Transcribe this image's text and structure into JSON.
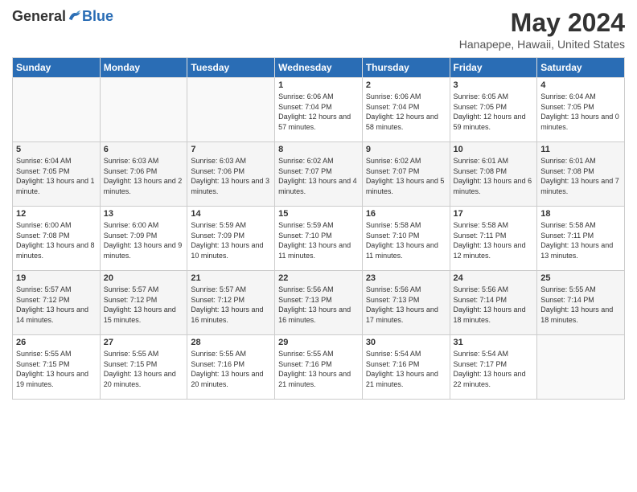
{
  "header": {
    "logo_general": "General",
    "logo_blue": "Blue",
    "title": "May 2024",
    "location": "Hanapepe, Hawaii, United States"
  },
  "days_of_week": [
    "Sunday",
    "Monday",
    "Tuesday",
    "Wednesday",
    "Thursday",
    "Friday",
    "Saturday"
  ],
  "weeks": [
    {
      "days": [
        {
          "number": "",
          "info": ""
        },
        {
          "number": "",
          "info": ""
        },
        {
          "number": "",
          "info": ""
        },
        {
          "number": "1",
          "info": "Sunrise: 6:06 AM\nSunset: 7:04 PM\nDaylight: 12 hours and 57 minutes."
        },
        {
          "number": "2",
          "info": "Sunrise: 6:06 AM\nSunset: 7:04 PM\nDaylight: 12 hours and 58 minutes."
        },
        {
          "number": "3",
          "info": "Sunrise: 6:05 AM\nSunset: 7:05 PM\nDaylight: 12 hours and 59 minutes."
        },
        {
          "number": "4",
          "info": "Sunrise: 6:04 AM\nSunset: 7:05 PM\nDaylight: 13 hours and 0 minutes."
        }
      ]
    },
    {
      "days": [
        {
          "number": "5",
          "info": "Sunrise: 6:04 AM\nSunset: 7:05 PM\nDaylight: 13 hours and 1 minute."
        },
        {
          "number": "6",
          "info": "Sunrise: 6:03 AM\nSunset: 7:06 PM\nDaylight: 13 hours and 2 minutes."
        },
        {
          "number": "7",
          "info": "Sunrise: 6:03 AM\nSunset: 7:06 PM\nDaylight: 13 hours and 3 minutes."
        },
        {
          "number": "8",
          "info": "Sunrise: 6:02 AM\nSunset: 7:07 PM\nDaylight: 13 hours and 4 minutes."
        },
        {
          "number": "9",
          "info": "Sunrise: 6:02 AM\nSunset: 7:07 PM\nDaylight: 13 hours and 5 minutes."
        },
        {
          "number": "10",
          "info": "Sunrise: 6:01 AM\nSunset: 7:08 PM\nDaylight: 13 hours and 6 minutes."
        },
        {
          "number": "11",
          "info": "Sunrise: 6:01 AM\nSunset: 7:08 PM\nDaylight: 13 hours and 7 minutes."
        }
      ]
    },
    {
      "days": [
        {
          "number": "12",
          "info": "Sunrise: 6:00 AM\nSunset: 7:08 PM\nDaylight: 13 hours and 8 minutes."
        },
        {
          "number": "13",
          "info": "Sunrise: 6:00 AM\nSunset: 7:09 PM\nDaylight: 13 hours and 9 minutes."
        },
        {
          "number": "14",
          "info": "Sunrise: 5:59 AM\nSunset: 7:09 PM\nDaylight: 13 hours and 10 minutes."
        },
        {
          "number": "15",
          "info": "Sunrise: 5:59 AM\nSunset: 7:10 PM\nDaylight: 13 hours and 11 minutes."
        },
        {
          "number": "16",
          "info": "Sunrise: 5:58 AM\nSunset: 7:10 PM\nDaylight: 13 hours and 11 minutes."
        },
        {
          "number": "17",
          "info": "Sunrise: 5:58 AM\nSunset: 7:11 PM\nDaylight: 13 hours and 12 minutes."
        },
        {
          "number": "18",
          "info": "Sunrise: 5:58 AM\nSunset: 7:11 PM\nDaylight: 13 hours and 13 minutes."
        }
      ]
    },
    {
      "days": [
        {
          "number": "19",
          "info": "Sunrise: 5:57 AM\nSunset: 7:12 PM\nDaylight: 13 hours and 14 minutes."
        },
        {
          "number": "20",
          "info": "Sunrise: 5:57 AM\nSunset: 7:12 PM\nDaylight: 13 hours and 15 minutes."
        },
        {
          "number": "21",
          "info": "Sunrise: 5:57 AM\nSunset: 7:12 PM\nDaylight: 13 hours and 16 minutes."
        },
        {
          "number": "22",
          "info": "Sunrise: 5:56 AM\nSunset: 7:13 PM\nDaylight: 13 hours and 16 minutes."
        },
        {
          "number": "23",
          "info": "Sunrise: 5:56 AM\nSunset: 7:13 PM\nDaylight: 13 hours and 17 minutes."
        },
        {
          "number": "24",
          "info": "Sunrise: 5:56 AM\nSunset: 7:14 PM\nDaylight: 13 hours and 18 minutes."
        },
        {
          "number": "25",
          "info": "Sunrise: 5:55 AM\nSunset: 7:14 PM\nDaylight: 13 hours and 18 minutes."
        }
      ]
    },
    {
      "days": [
        {
          "number": "26",
          "info": "Sunrise: 5:55 AM\nSunset: 7:15 PM\nDaylight: 13 hours and 19 minutes."
        },
        {
          "number": "27",
          "info": "Sunrise: 5:55 AM\nSunset: 7:15 PM\nDaylight: 13 hours and 20 minutes."
        },
        {
          "number": "28",
          "info": "Sunrise: 5:55 AM\nSunset: 7:16 PM\nDaylight: 13 hours and 20 minutes."
        },
        {
          "number": "29",
          "info": "Sunrise: 5:55 AM\nSunset: 7:16 PM\nDaylight: 13 hours and 21 minutes."
        },
        {
          "number": "30",
          "info": "Sunrise: 5:54 AM\nSunset: 7:16 PM\nDaylight: 13 hours and 21 minutes."
        },
        {
          "number": "31",
          "info": "Sunrise: 5:54 AM\nSunset: 7:17 PM\nDaylight: 13 hours and 22 minutes."
        },
        {
          "number": "",
          "info": ""
        }
      ]
    }
  ]
}
